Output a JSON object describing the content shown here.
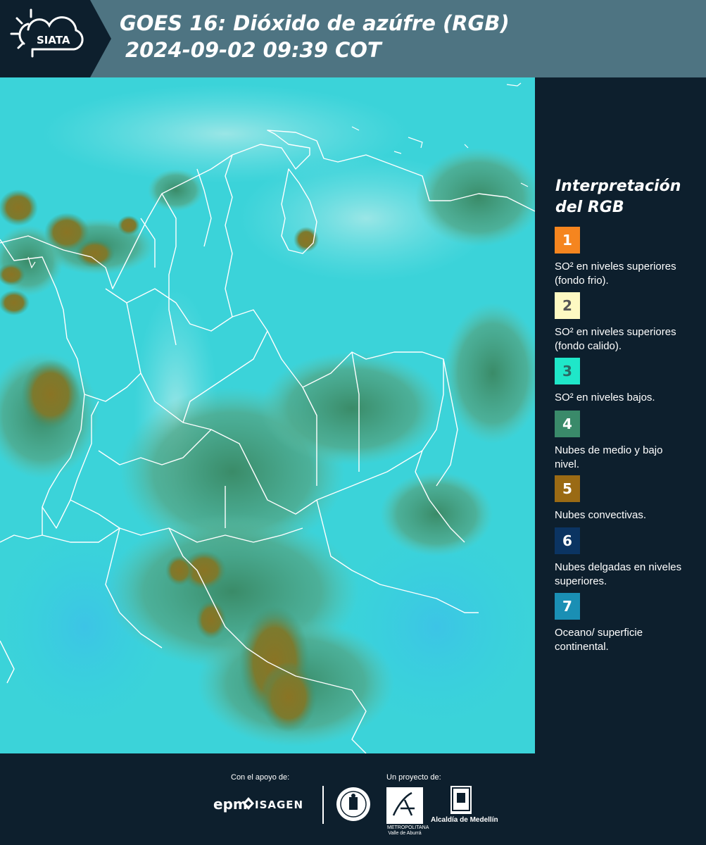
{
  "header": {
    "logo_text": "SIATA",
    "title_line1": "GOES 16: Dióxido de azúfre (RGB)",
    "title_line2": "2024-09-02 09:39 COT",
    "background_color": "#4e7482"
  },
  "legend": {
    "title": "Interpretación del RGB",
    "items": [
      {
        "number": "1",
        "text": "SO² en niveles superiores (fondo frio).",
        "color": "#f5851f",
        "number_color": "#ffffff"
      },
      {
        "number": "2",
        "text": "SO² en niveles superiores (fondo calido).",
        "color": "#fdf9c2",
        "number_color": "#555555"
      },
      {
        "number": "3",
        "text": "SO² en niveles bajos.",
        "color": "#1fe7c9",
        "number_color": "#2a6a64"
      },
      {
        "number": "4",
        "text": "Nubes de medio y bajo nivel.",
        "color": "#3a8a6a",
        "number_color": "#ffffff"
      },
      {
        "number": "5",
        "text": "Nubes convectivas.",
        "color": "#9a6a14",
        "number_color": "#ffffff"
      },
      {
        "number": "6",
        "text": "Nubes delgadas en niveles superiores.",
        "color": "#0b3462",
        "number_color": "#ffffff"
      },
      {
        "number": "7",
        "text": "Oceano/ superficie continental.",
        "color": "#1a8fb4",
        "number_color": "#ffffff"
      }
    ]
  },
  "map": {
    "icon": "satellite-map",
    "background_color": "#37d2d9",
    "cloud_colors": [
      "#8a7a2c",
      "#3f8e6a",
      "#6fc4a8"
    ]
  },
  "footer": {
    "support_label": "Con el apoyo de:",
    "project_label": "Un proyecto de:",
    "epm_text": "epm",
    "isagen_text": "ISAGEN",
    "area_text": "METROPOLITANA Valle de Aburrá",
    "alcaldia_text": "Alcaldía de Medellín"
  }
}
